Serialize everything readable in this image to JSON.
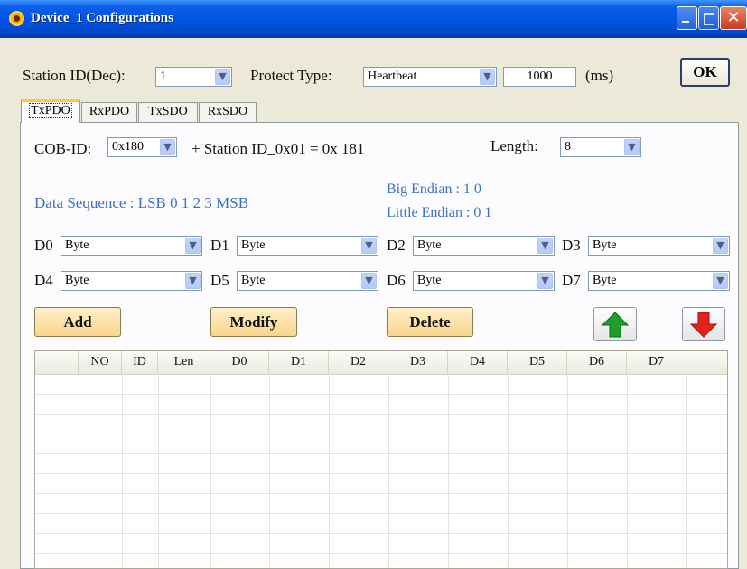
{
  "window": {
    "title": "Device_1 Configurations",
    "close_glyph": "✕"
  },
  "top": {
    "station_label": "Station ID(Dec):",
    "station_value": "1",
    "protect_label": "Protect Type:",
    "protect_value": "Heartbeat",
    "interval_value": "1000",
    "interval_unit": "(ms)",
    "ok_label": "OK"
  },
  "tabs": [
    {
      "label": "TxPDO",
      "active": true
    },
    {
      "label": "RxPDO",
      "active": false
    },
    {
      "label": "TxSDO",
      "active": false
    },
    {
      "label": "RxSDO",
      "active": false
    }
  ],
  "cob": {
    "label": "COB-ID:",
    "value": "0x180",
    "plus_text": "+  Station ID_0x01  = 0x 181",
    "length_label": "Length:",
    "length_value": "8"
  },
  "sequence": {
    "text": "Data Sequence : LSB   0   1   2   3   MSB",
    "big_endian": "Big Endian :   1  0",
    "little_endian": "Little Endian : 0  1"
  },
  "fields": [
    {
      "label": "D0",
      "value": "Byte"
    },
    {
      "label": "D1",
      "value": "Byte"
    },
    {
      "label": "D2",
      "value": "Byte"
    },
    {
      "label": "D3",
      "value": "Byte"
    },
    {
      "label": "D4",
      "value": "Byte"
    },
    {
      "label": "D5",
      "value": "Byte"
    },
    {
      "label": "D6",
      "value": "Byte"
    },
    {
      "label": "D7",
      "value": "Byte"
    }
  ],
  "buttons": {
    "add": "Add",
    "modify": "Modify",
    "delete": "Delete"
  },
  "table": {
    "columns": [
      "NO",
      "ID",
      "Len",
      "D0",
      "D1",
      "D2",
      "D3",
      "D4",
      "D5",
      "D6",
      "D7"
    ],
    "rows": []
  },
  "colors": {
    "titlebar": "#0054e3",
    "button_fill": "#fad58c",
    "accent_text": "#3a6fc4",
    "up_arrow": "#1f9e2c",
    "down_arrow": "#e0241b"
  },
  "icons": {
    "up": "green-up-arrow-icon",
    "down": "red-down-arrow-icon"
  }
}
